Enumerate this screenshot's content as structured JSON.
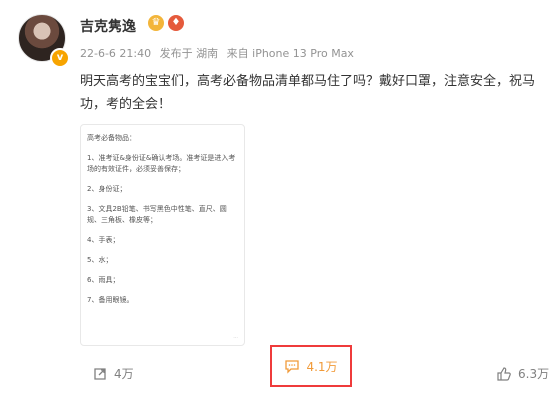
{
  "user": {
    "name": "吉克隽逸",
    "verified_mark": "v"
  },
  "meta": {
    "datetime": "22-6-6 21:40",
    "location": "发布于 湖南",
    "source": "来自 iPhone 13 Pro Max"
  },
  "post": {
    "line1": "明天高考的宝宝们，高考必备物品清单都马住了吗？戴好口罩，注意安全，祝马",
    "line2": "功，考的全会！"
  },
  "note": {
    "title": "高考必备物品：",
    "items": [
      "1、准考证&身份证&确认考场。准考证是进入考场的有效证件，必须妥善保存；",
      "2、身份证；",
      "3、文具2B铅笔、书写黑色中性笔、直尺、圆规、三角板、橡皮等；",
      "4、手表；",
      "5、水；",
      "6、雨具；",
      "7、备用眼镜。"
    ]
  },
  "actions": {
    "repost_count": "4万",
    "comment_count": "4.1万",
    "like_count": "6.3万"
  },
  "colors": {
    "accent_orange": "#f19a38",
    "highlight_red": "#ef3b3b"
  }
}
